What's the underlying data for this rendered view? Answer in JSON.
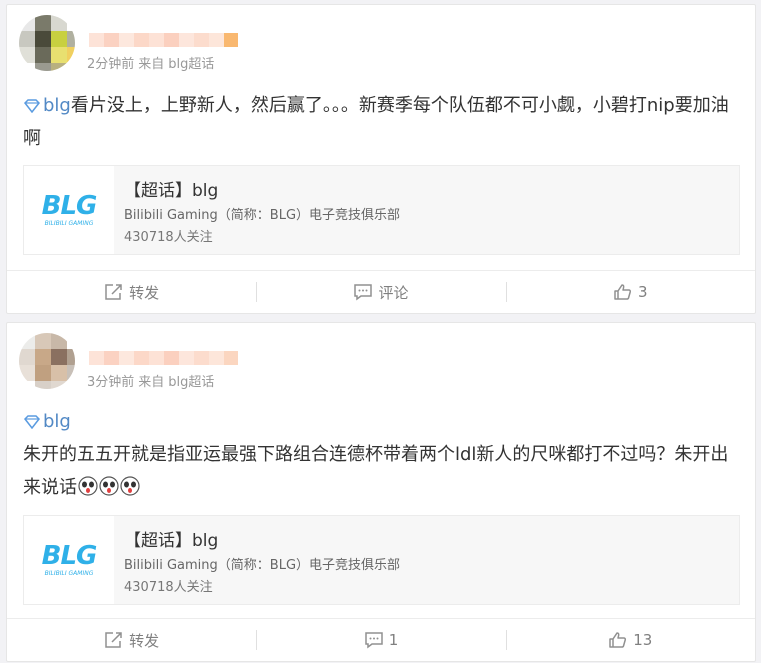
{
  "posts": [
    {
      "meta": {
        "time": "2分钟前",
        "source": "来自",
        "source_name": "blg超话"
      },
      "topic_tag": "blg",
      "text": "看片没上，上野新人，然后赢了。。。新赛季每个队伍都不可小觑，小碧打nip要加油啊",
      "topic_card": {
        "title": "【超话】blg",
        "desc": "Bilibili Gaming（简称：BLG）电子竞技俱乐部",
        "followers": "430718人关注",
        "logo_text": "BLG",
        "logo_sub": "BILIBILI GAMING"
      },
      "actions": {
        "repost": "转发",
        "comment": "评论",
        "like": "3"
      }
    },
    {
      "meta": {
        "time": "3分钟前",
        "source": "来自",
        "source_name": "blg超话"
      },
      "topic_tag": "blg",
      "text": "朱开的五五开就是指亚运最强下路组合连德杯带着两个ldl新人的尺咪都打不过吗？朱开出来说话",
      "topic_card": {
        "title": "【超话】blg",
        "desc": "Bilibili Gaming（简称：BLG）电子竞技俱乐部",
        "followers": "430718人关注",
        "logo_text": "BLG",
        "logo_sub": "BILIBILI GAMING"
      },
      "actions": {
        "repost": "转发",
        "comment": "1",
        "like": "13"
      }
    }
  ],
  "colors": {
    "accent": "#eb7350",
    "link": "#5289c5",
    "logo": "#2fb0e8"
  }
}
